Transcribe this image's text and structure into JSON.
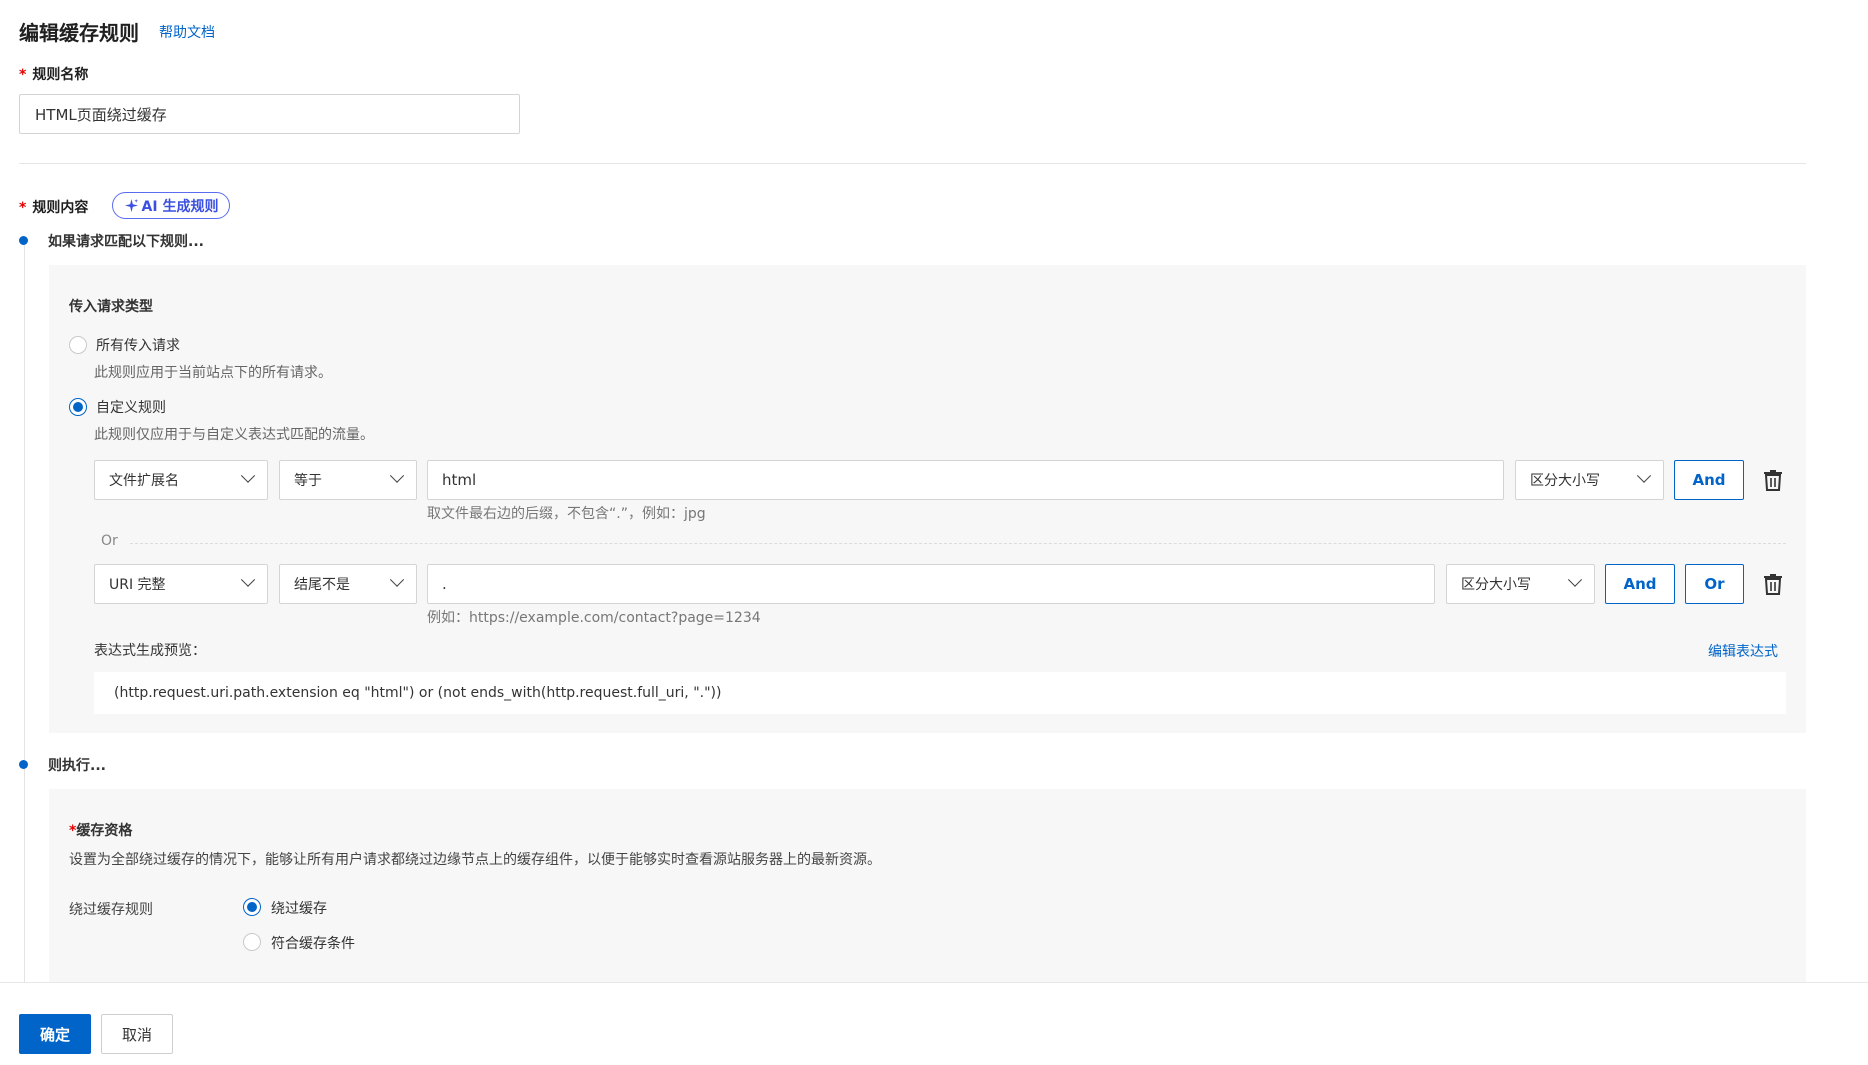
{
  "header": {
    "title": "编辑缓存规则",
    "help_link": "帮助文档"
  },
  "rule_name": {
    "required_mark": "*",
    "label": "规则名称",
    "value": "HTML页面绕过缓存"
  },
  "rule_content": {
    "required_mark": "*",
    "label": "规则内容",
    "ai_button": "AI 生成规则"
  },
  "if_section": {
    "label": "如果请求匹配以下规则...",
    "request_type_title": "传入请求类型",
    "options": [
      {
        "label": "所有传入请求",
        "desc": "此规则应用于当前站点下的所有请求。",
        "checked": false
      },
      {
        "label": "自定义规则",
        "desc": "此规则仅应用于与自定义表达式匹配的流量。",
        "checked": true
      }
    ],
    "conditions": [
      {
        "field": "文件扩展名",
        "operator": "等于",
        "value": "html",
        "case": "区分大小写",
        "hint": "取文件最右边的后缀，不包含“.”，例如：jpg",
        "buttons": [
          "And"
        ]
      },
      {
        "field": "URI 完整",
        "operator": "结尾不是",
        "value": ".",
        "case": "区分大小写",
        "hint": "例如：https://example.com/contact?page=1234",
        "buttons": [
          "And",
          "Or"
        ]
      }
    ],
    "or_separator": "Or",
    "preview_label": "表达式生成预览：",
    "edit_expression": "编辑表达式",
    "expression": "(http.request.uri.path.extension eq \"html\") or (not ends_with(http.request.full_uri, \".\"))"
  },
  "then_section": {
    "label": "则执行...",
    "required_mark": "*",
    "cache_title": "缓存资格",
    "cache_desc": "设置为全部绕过缓存的情况下，能够让所有用户请求都绕过边缘节点上的缓存组件，以便于能够实时查看源站服务器上的最新资源。",
    "bypass_label": "绕过缓存规则",
    "options": [
      {
        "label": "绕过缓存",
        "checked": true
      },
      {
        "label": "符合缓存条件",
        "checked": false
      }
    ]
  },
  "footer": {
    "confirm": "确定",
    "cancel": "取消"
  },
  "colors": {
    "primary": "#0064c8",
    "required": "#e60000",
    "ai_accent": "#3b4fe0"
  }
}
